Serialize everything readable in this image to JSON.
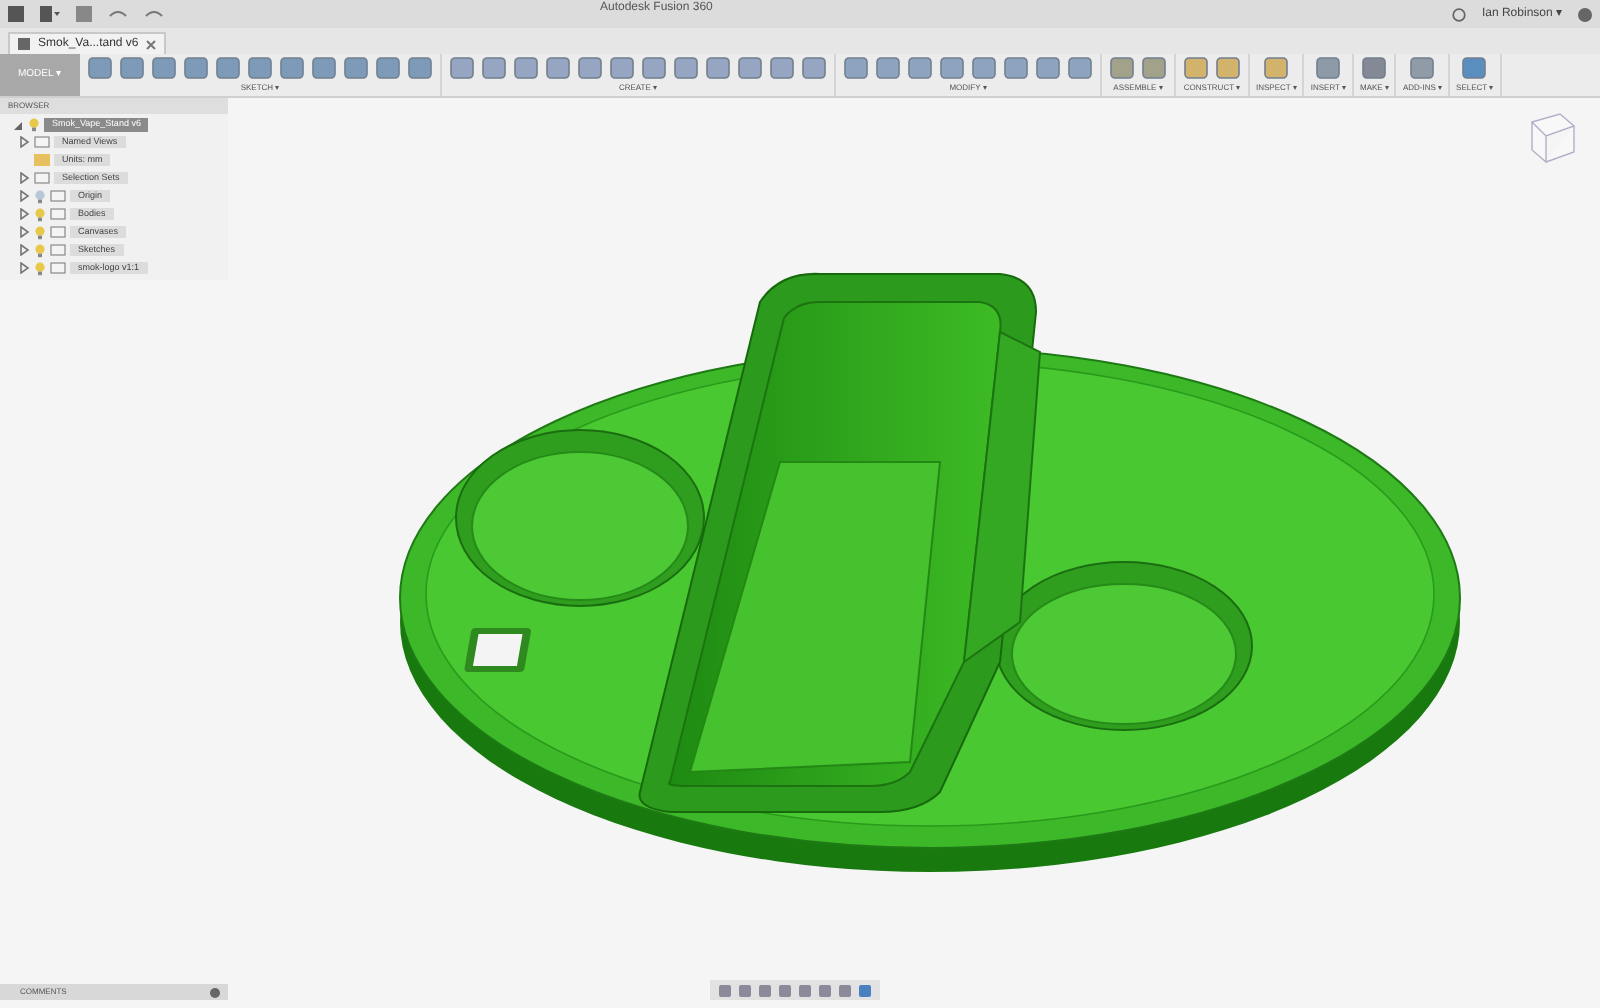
{
  "window": {
    "title": "Autodesk Fusion 360"
  },
  "user": {
    "name": "Ian Robinson ▾"
  },
  "document_tab": {
    "label": "Smok_Va...tand v6"
  },
  "workspace": {
    "label": "MODEL ▾"
  },
  "toolbar": {
    "groups": [
      {
        "label": "SKETCH ▾"
      },
      {
        "label": "CREATE ▾"
      },
      {
        "label": "MODIFY ▾"
      },
      {
        "label": "ASSEMBLE ▾"
      },
      {
        "label": "CONSTRUCT ▾"
      },
      {
        "label": "INSPECT ▾"
      },
      {
        "label": "INSERT ▾"
      },
      {
        "label": "MAKE ▾"
      },
      {
        "label": "ADD-INS ▾"
      },
      {
        "label": "SELECT ▾"
      }
    ]
  },
  "browser": {
    "title": "BROWSER",
    "root": {
      "label": "Smok_Vape_Stand v6",
      "expanded": true,
      "children": [
        {
          "label": "Named Views",
          "kind": "folder",
          "expanded": false
        },
        {
          "label": "Units: mm",
          "kind": "units"
        },
        {
          "label": "Selection Sets",
          "kind": "folder",
          "expanded": false
        },
        {
          "label": "Origin",
          "kind": "folder",
          "visible": false,
          "expanded": false
        },
        {
          "label": "Bodies",
          "kind": "folder",
          "visible": true,
          "expanded": false
        },
        {
          "label": "Canvases",
          "kind": "folder",
          "visible": true,
          "expanded": false
        },
        {
          "label": "Sketches",
          "kind": "folder",
          "visible": true,
          "expanded": false
        },
        {
          "label": "smok-logo v1:1",
          "kind": "component",
          "visible": true,
          "expanded": false
        }
      ]
    }
  },
  "comments": {
    "title": "COMMENTS"
  }
}
